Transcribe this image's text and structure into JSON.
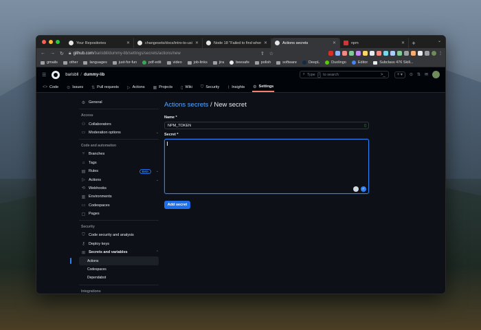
{
  "browser": {
    "tabs": [
      {
        "title": "Your Repositories"
      },
      {
        "title": "changesets/docs/intro-to-usi"
      },
      {
        "title": "Node 18 \"Failed to find where"
      },
      {
        "title": "Actions secrets"
      },
      {
        "title": "npm"
      }
    ],
    "url": {
      "host": "github.com",
      "path": "/barisbll/dummy-lib/settings/secrets/actions/new"
    },
    "bookmarks": [
      "gmails",
      "other",
      "languages",
      "just-for-fun",
      "pdf-edit",
      "video",
      "job-links",
      "jira",
      "beesafe",
      "polish",
      "software",
      "DeepL",
      "Duolingo",
      "Editor",
      "Subclass 476 Skill..."
    ]
  },
  "github": {
    "owner": "barisbll",
    "separator": "/",
    "repo": "dummy-lib",
    "search_placeholder": "Type / to search",
    "search_prefix": "Type",
    "search_slash": "/",
    "search_suffix": "to search",
    "nav": [
      "Code",
      "Issues",
      "Pull requests",
      "Actions",
      "Projects",
      "Wiki",
      "Security",
      "Insights",
      "Settings"
    ]
  },
  "sidebar": {
    "general": "General",
    "access_heading": "Access",
    "collaborators": "Collaborators",
    "moderation": "Moderation options",
    "code_heading": "Code and automation",
    "branches": "Branches",
    "tags": "Tags",
    "rules": "Rules",
    "rules_badge": "Beta",
    "actions": "Actions",
    "webhooks": "Webhooks",
    "environments": "Environments",
    "codespaces": "Codespaces",
    "pages": "Pages",
    "security_heading": "Security",
    "code_security": "Code security and analysis",
    "deploy_keys": "Deploy keys",
    "secrets": "Secrets and variables",
    "secrets_sub": [
      "Actions",
      "Codespaces",
      "Dependabot"
    ],
    "integrations_heading": "Integrations"
  },
  "form": {
    "heading_link": "Actions secrets",
    "heading_sep": " / ",
    "heading_rest": "New secret",
    "name_label": "Name *",
    "name_value": "NPM_TOKEN",
    "secret_label": "Secret *",
    "secret_value": "",
    "submit": "Add secret"
  },
  "colors": {
    "accent": "#1f6feb",
    "link": "#58a6ff",
    "active_tab_underline": "#f78166",
    "bg": "#0d1117"
  }
}
